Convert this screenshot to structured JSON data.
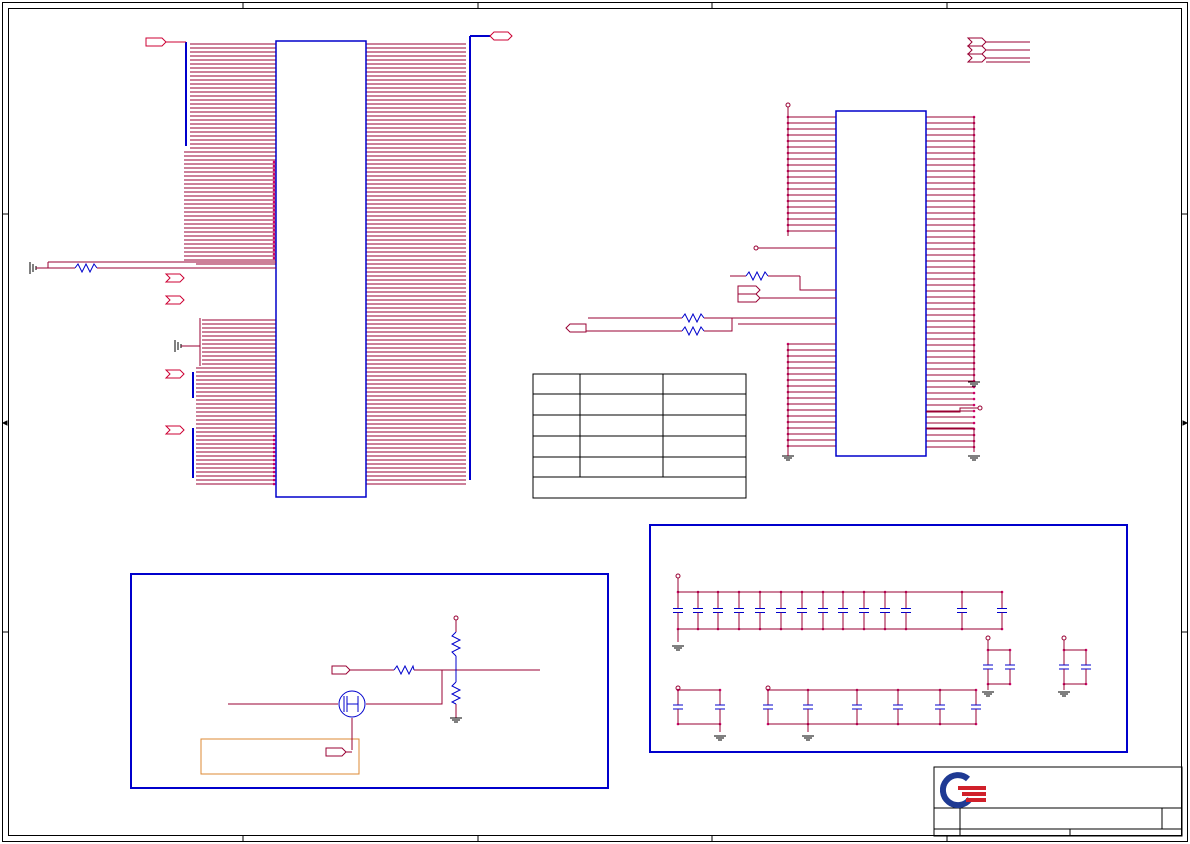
{
  "schematic": {
    "colors": {
      "border": "#000000",
      "bus": "#0000cc",
      "wire": "#990033",
      "junction": "#cc0066",
      "note_box": "#dd8833",
      "logo_blue": "#1f3a93",
      "logo_red": "#d0202a"
    },
    "sheet_grid": {
      "columns": 5,
      "rows": 4
    },
    "title_block": {
      "logo": "company-logo",
      "title": "",
      "rev": ""
    },
    "pin_table": {
      "rows": 5,
      "columns": 3
    }
  }
}
